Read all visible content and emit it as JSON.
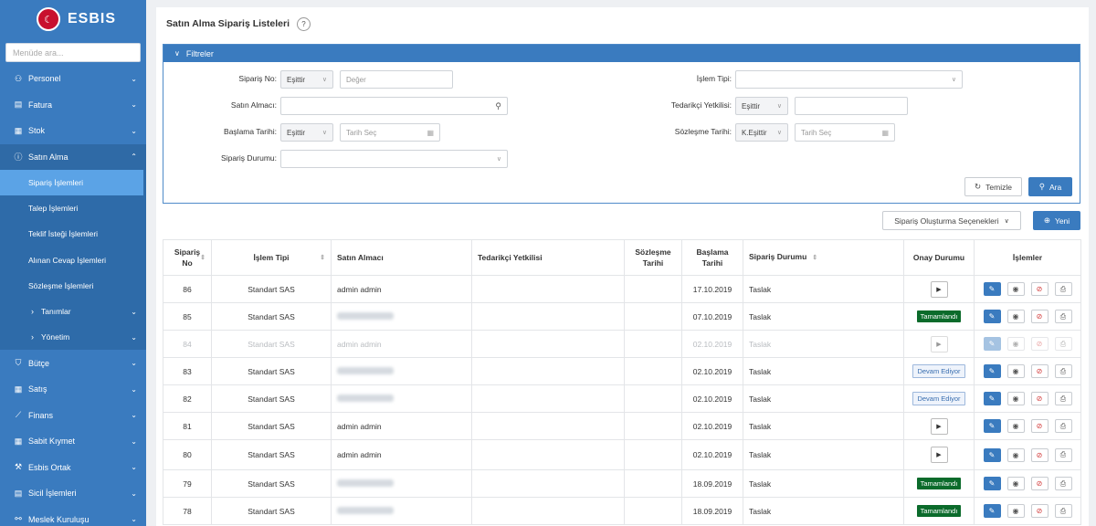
{
  "app": {
    "name": "ESBIS",
    "seal": "☾"
  },
  "sidebar": {
    "search_placeholder": "Menüde ara...",
    "items": [
      {
        "label": "Personel",
        "icon": "users-icon",
        "glyph": "⚇"
      },
      {
        "label": "Fatura",
        "icon": "invoice-icon",
        "glyph": "▤"
      },
      {
        "label": "Stok",
        "icon": "grid-icon",
        "glyph": "▦"
      },
      {
        "label": "Satın Alma",
        "icon": "info-circle-icon",
        "glyph": "ⓘ"
      },
      {
        "label": "Bütçe",
        "icon": "shield-icon",
        "glyph": "⛉"
      },
      {
        "label": "Satış",
        "icon": "grid-icon",
        "glyph": "▦"
      },
      {
        "label": "Finans",
        "icon": "chart-line-icon",
        "glyph": "⟋"
      },
      {
        "label": "Sabit Kıymet",
        "icon": "grid-icon",
        "glyph": "▦"
      },
      {
        "label": "Esbis Ortak",
        "icon": "wrench-icon",
        "glyph": "⚒"
      },
      {
        "label": "Sicil İşlemleri",
        "icon": "document-icon",
        "glyph": "▤"
      },
      {
        "label": "Meslek Kuruluşu",
        "icon": "network-icon",
        "glyph": "⚯"
      }
    ],
    "sub_items": [
      {
        "label": "Sipariş İşlemleri"
      },
      {
        "label": "Talep İşlemleri"
      },
      {
        "label": "Teklif İsteği İşlemleri"
      },
      {
        "label": "Alınan Cevap İşlemleri"
      },
      {
        "label": "Sözleşme İşlemleri"
      },
      {
        "label": "Tanımlar"
      },
      {
        "label": "Yönetim"
      }
    ]
  },
  "page": {
    "title": "Satın Alma Sipariş Listeleri",
    "help": "?"
  },
  "filters": {
    "header": "Filtreler",
    "siparis_no_label": "Sipariş No",
    "siparis_no_op": "Eşittir",
    "siparis_no_placeholder": "Değer",
    "satin_almaci_label": "Satın Almacı",
    "baslama_label": "Başlama Tarihi",
    "baslama_op": "Eşittir",
    "date_placeholder": "Tarih Seç",
    "siparis_durumu_label": "Sipariş Durumu",
    "islem_tipi_label": "İşlem Tipi",
    "tedarikci_label": "Tedarikçi Yetkilisi",
    "tedarikci_op": "Eşittir",
    "sozlesme_label": "Sözleşme Tarihi",
    "sozlesme_op": "K.Eşittir",
    "clear_label": "Temizle",
    "search_label": "Ara"
  },
  "toolbar": {
    "options_label": "Sipariş Oluşturma Seçenekleri",
    "new_label": "Yeni"
  },
  "table": {
    "columns": {
      "no": "Sipariş No",
      "tip": "İşlem Tipi",
      "almaci": "Satın Almacı",
      "tedarikci": "Tedarikçi Yetkilisi",
      "sozlesme": "Sözleşme Tarihi",
      "baslama": "Başlama Tarihi",
      "durum": "Sipariş Durumu",
      "onay": "Onay Durumu",
      "islemler": "İşlemler"
    },
    "rows": [
      {
        "no": "86",
        "tip": "Standart SAS",
        "almaci": "admin admin",
        "baslama": "17.10.2019",
        "durum": "Taslak",
        "onay": "play"
      },
      {
        "no": "85",
        "tip": "Standart SAS",
        "almaci": "",
        "baslama": "07.10.2019",
        "durum": "Taslak",
        "onay": "Tamamlandı"
      },
      {
        "no": "84",
        "tip": "Standart SAS",
        "almaci": "admin admin",
        "baslama": "02.10.2019",
        "durum": "Taslak",
        "onay": "play",
        "muted": true
      },
      {
        "no": "83",
        "tip": "Standart SAS",
        "almaci": "",
        "baslama": "02.10.2019",
        "durum": "Taslak",
        "onay": "Devam Ediyor"
      },
      {
        "no": "82",
        "tip": "Standart SAS",
        "almaci": "",
        "baslama": "02.10.2019",
        "durum": "Taslak",
        "onay": "Devam Ediyor"
      },
      {
        "no": "81",
        "tip": "Standart SAS",
        "almaci": "admin admin",
        "baslama": "02.10.2019",
        "durum": "Taslak",
        "onay": "play"
      },
      {
        "no": "80",
        "tip": "Standart SAS",
        "almaci": "admin admin",
        "baslama": "02.10.2019",
        "durum": "Taslak",
        "onay": "play"
      },
      {
        "no": "79",
        "tip": "Standart SAS",
        "almaci": "",
        "baslama": "18.09.2019",
        "durum": "Taslak",
        "onay": "Tamamlandı"
      },
      {
        "no": "78",
        "tip": "Standart SAS",
        "almaci": "",
        "baslama": "18.09.2019",
        "durum": "Taslak",
        "onay": "Tamamlandı"
      }
    ]
  },
  "colors": {
    "accent": "#3a7bbf",
    "sidebar": "#3a7bbf",
    "active": "#5ba3e6",
    "done": "#0b6b2b"
  }
}
